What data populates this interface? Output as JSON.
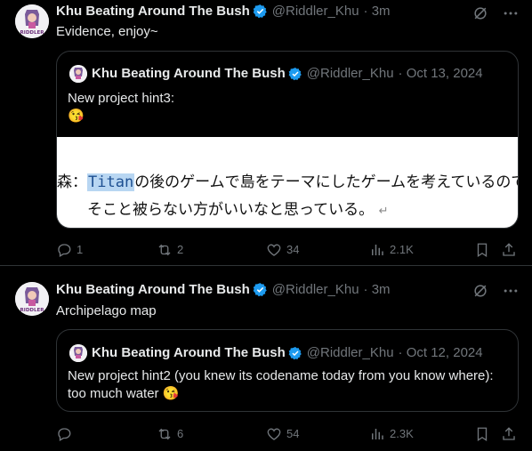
{
  "tweets": [
    {
      "author_name": "Khu Beating Around The Bush",
      "handle": "@Riddler_Khu",
      "time": "· 3m",
      "text": "Evidence, enjoy~",
      "avatar_caption": "RIDDLER",
      "quote": {
        "author_name": "Khu Beating Around The Bush",
        "handle": "@Riddler_Khu",
        "date": "· Oct 13, 2024",
        "text_line1": "New project hint3:",
        "emoji": "😘",
        "image_text": {
          "speaker": "森：",
          "highlight": "Titan",
          "line1_rest": "の後のゲームで島をテーマにしたゲームを考えているので",
          "line2": "そこと被らない方がいいなと思っている。",
          "return_mark": "↵"
        }
      },
      "stats": {
        "replies": "1",
        "reposts": "2",
        "likes": "34",
        "views": "2.1K"
      }
    },
    {
      "author_name": "Khu Beating Around The Bush",
      "handle": "@Riddler_Khu",
      "time": "· 3m",
      "text": "Archipelago map",
      "avatar_caption": "RIDDLER",
      "quote": {
        "author_name": "Khu Beating Around The Bush",
        "handle": "@Riddler_Khu",
        "date": "· Oct 12, 2024",
        "text_line1": "New project hint2 (you knew its codename today from you know where):",
        "text_line2": "too much water",
        "emoji": "😘"
      },
      "stats": {
        "replies": "",
        "reposts": "6",
        "likes": "54",
        "views": "2.3K"
      }
    }
  ],
  "colors": {
    "background": "#000000",
    "text": "#e7e9ea",
    "muted": "#71767b",
    "border": "#2f3336",
    "verified": "#1d9bf0"
  },
  "icons": [
    "verified-badge-icon",
    "grok-icon",
    "more-icon",
    "reply-icon",
    "repost-icon",
    "like-icon",
    "views-icon",
    "bookmark-icon",
    "share-icon"
  ]
}
